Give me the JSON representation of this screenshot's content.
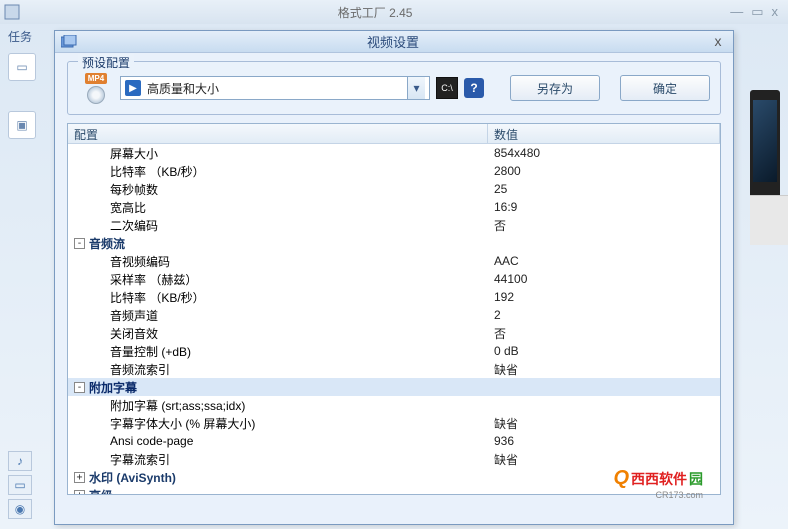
{
  "main": {
    "title": "格式工厂 2.45",
    "sidebar_tab": "任务",
    "sysbtns": {
      "min": "—",
      "max": "▭",
      "close": "x"
    }
  },
  "dialog": {
    "title": "视频设置",
    "close": "x"
  },
  "preset": {
    "legend": "预设配置",
    "badge": "MP4",
    "selected": "高质量和大小",
    "saveas": "另存为",
    "ok": "确定",
    "help": "?",
    "cmd": "C:\\"
  },
  "table": {
    "header_config": "配置",
    "header_value": "数值",
    "rows": [
      {
        "type": "item",
        "indent": 2,
        "label": "屏幕大小",
        "value": "854x480"
      },
      {
        "type": "item",
        "indent": 2,
        "label": "比特率 （KB/秒）",
        "value": "2800"
      },
      {
        "type": "item",
        "indent": 2,
        "label": "每秒帧数",
        "value": "25"
      },
      {
        "type": "item",
        "indent": 2,
        "label": "宽高比",
        "value": "16:9"
      },
      {
        "type": "item",
        "indent": 2,
        "label": "二次编码",
        "value": "否"
      },
      {
        "type": "group",
        "indent": 1,
        "label": "音频流",
        "expanded": true
      },
      {
        "type": "item",
        "indent": 2,
        "label": "音视频编码",
        "value": "AAC"
      },
      {
        "type": "item",
        "indent": 2,
        "label": "采样率 （赫兹）",
        "value": "44100"
      },
      {
        "type": "item",
        "indent": 2,
        "label": "比特率 （KB/秒）",
        "value": "192"
      },
      {
        "type": "item",
        "indent": 2,
        "label": "音频声道",
        "value": "2"
      },
      {
        "type": "item",
        "indent": 2,
        "label": "关闭音效",
        "value": "否"
      },
      {
        "type": "item",
        "indent": 2,
        "label": "音量控制 (+dB)",
        "value": "0 dB"
      },
      {
        "type": "item",
        "indent": 2,
        "label": "音频流索引",
        "value": "缺省"
      },
      {
        "type": "group",
        "indent": 1,
        "label": "附加字幕",
        "expanded": true,
        "selected": true
      },
      {
        "type": "item",
        "indent": 2,
        "label": "附加字幕 (srt;ass;ssa;idx)",
        "value": ""
      },
      {
        "type": "item",
        "indent": 2,
        "label": "字幕字体大小 (% 屏幕大小)",
        "value": "缺省"
      },
      {
        "type": "item",
        "indent": 2,
        "label": "Ansi code-page",
        "value": "936"
      },
      {
        "type": "item",
        "indent": 2,
        "label": "字幕流索引",
        "value": "缺省"
      },
      {
        "type": "group",
        "indent": 1,
        "label": "水印 (AviSynth)",
        "expanded": false
      },
      {
        "type": "group",
        "indent": 1,
        "label": "高级",
        "expanded": false
      }
    ]
  },
  "watermark": {
    "q": "Q",
    "text_cn": "西西软件",
    "text_suf": "园",
    "sub": "CR173.com"
  }
}
